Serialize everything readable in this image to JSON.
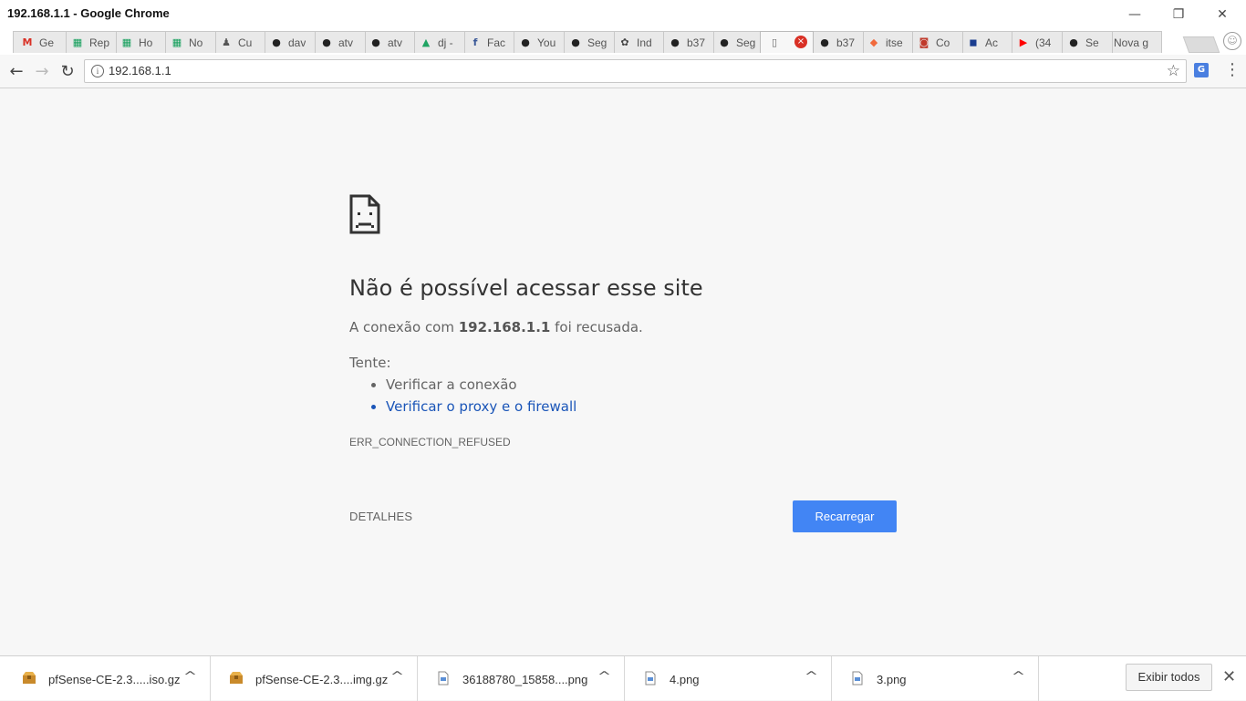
{
  "window": {
    "title": "192.168.1.1 - Google Chrome",
    "minimize_glyph": "—",
    "restore_glyph": "❐",
    "close_glyph": "✕"
  },
  "tabs": [
    {
      "label": "Ge",
      "icon": "gmail-icon",
      "glyph": "M",
      "color": "#d93025"
    },
    {
      "label": "Rep",
      "icon": "sheets-icon",
      "glyph": "▦",
      "color": "#0f9d58"
    },
    {
      "label": "Ho",
      "icon": "sheets-icon",
      "glyph": "▦",
      "color": "#0f9d58"
    },
    {
      "label": "No",
      "icon": "sheets-icon",
      "glyph": "▦",
      "color": "#0f9d58"
    },
    {
      "label": "Cu",
      "icon": "app-icon",
      "glyph": "♟",
      "color": "#555555"
    },
    {
      "label": "dav",
      "icon": "github-icon",
      "glyph": "●",
      "color": "#222222"
    },
    {
      "label": "atv",
      "icon": "github-icon",
      "glyph": "●",
      "color": "#222222"
    },
    {
      "label": "atv",
      "icon": "github-icon",
      "glyph": "●",
      "color": "#222222"
    },
    {
      "label": "dj -",
      "icon": "drive-icon",
      "glyph": "▲",
      "color": "#1fa463"
    },
    {
      "label": "Fac",
      "icon": "facebook-icon",
      "glyph": "f",
      "color": "#3b5998"
    },
    {
      "label": "You",
      "icon": "github-icon",
      "glyph": "●",
      "color": "#222222"
    },
    {
      "label": "Seg",
      "icon": "github-icon",
      "glyph": "●",
      "color": "#222222"
    },
    {
      "label": "Ind",
      "icon": "app-icon",
      "glyph": "✿",
      "color": "#444444"
    },
    {
      "label": "b37",
      "icon": "github-icon",
      "glyph": "●",
      "color": "#222222"
    },
    {
      "label": "Seg",
      "icon": "github-icon",
      "glyph": "●",
      "color": "#222222"
    },
    {
      "label": "",
      "icon": "page-icon",
      "glyph": "▯",
      "color": "#666666",
      "active": true
    },
    {
      "label": "b37",
      "icon": "github-icon",
      "glyph": "●",
      "color": "#222222"
    },
    {
      "label": "itse",
      "icon": "shield-icon",
      "glyph": "◆",
      "color": "#f16a3c"
    },
    {
      "label": "Co",
      "icon": "app-icon",
      "glyph": "◙",
      "color": "#c0392b"
    },
    {
      "label": "Ac",
      "icon": "app-icon",
      "glyph": "◼",
      "color": "#1a3d8f"
    },
    {
      "label": "(34",
      "icon": "youtube-icon",
      "glyph": "▶",
      "color": "#ff0000"
    },
    {
      "label": "Se",
      "icon": "github-icon",
      "glyph": "●",
      "color": "#222222"
    },
    {
      "label": "Nova g",
      "icon": "",
      "glyph": "",
      "color": "#555555"
    }
  ],
  "toolbar": {
    "back_glyph": "←",
    "forward_glyph": "→",
    "reload_glyph": "↻",
    "url": "192.168.1.1",
    "info_glyph": "i",
    "star_glyph": "☆",
    "translate_glyph": "G",
    "menu_glyph": "⋮"
  },
  "error": {
    "heading": "Não é possível acessar esse site",
    "summary_prefix": "A conexão com ",
    "summary_host": "192.168.1.1",
    "summary_suffix": " foi recusada.",
    "try_label": "Tente:",
    "suggestions": [
      {
        "text": "Verificar a conexão",
        "link": false
      },
      {
        "text": "Verificar o proxy e o firewall",
        "link": true
      }
    ],
    "code": "ERR_CONNECTION_REFUSED",
    "details_label": "DETALHES",
    "reload_label": "Recarregar"
  },
  "downloads": {
    "items": [
      {
        "name": "pfSense-CE-2.3.....iso.gz",
        "icon": "archive-icon"
      },
      {
        "name": "pfSense-CE-2.3....img.gz",
        "icon": "archive-icon"
      },
      {
        "name": "36188780_15858....png",
        "icon": "image-file-icon"
      },
      {
        "name": "4.png",
        "icon": "image-file-icon"
      },
      {
        "name": "3.png",
        "icon": "image-file-icon"
      }
    ],
    "caret_glyph": "^",
    "show_all_label": "Exibir todos",
    "close_glyph": "✕"
  },
  "colors": {
    "accent": "#4285f4",
    "link": "#1a55b8",
    "error_red": "#d93025"
  }
}
